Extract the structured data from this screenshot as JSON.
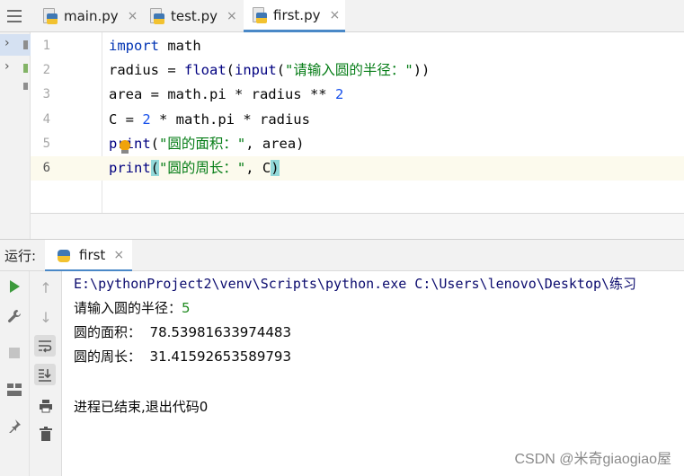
{
  "tabs": [
    {
      "label": "main.py",
      "close": "×"
    },
    {
      "label": "test.py",
      "close": "×"
    },
    {
      "label": "first.py",
      "close": "×"
    }
  ],
  "editor": {
    "line_numbers": [
      "1",
      "2",
      "3",
      "4",
      "5",
      "6"
    ],
    "code": {
      "l1_kw": "import",
      "l1_rest": " math",
      "l2_a": "radius = ",
      "l2_float": "float",
      "l2_b": "(",
      "l2_input": "input",
      "l2_c": "(",
      "l2_str": "\"请输入圆的半径：\"",
      "l2_d": "))",
      "l3_a": "area = math.pi * radius ** ",
      "l3_num": "2",
      "l4_a": "C = ",
      "l4_num": "2",
      "l4_b": " * math.pi * radius",
      "l5_fn": "print",
      "l5_a": "(",
      "l5_str": "\"圆的面积：\"",
      "l5_b": ", area)",
      "l6_fn": "print",
      "l6_a": "(",
      "l6_str": "\"圆的周长：\"",
      "l6_b": ", C",
      "l6_c": ")"
    }
  },
  "run": {
    "label": "运行:",
    "tab_label": "first",
    "tab_close": "×"
  },
  "console": {
    "cmd": "E:\\pythonProject2\\venv\\Scripts\\python.exe C:\\Users\\lenovo\\Desktop\\练习",
    "prompt": "请输入圆的半径：",
    "input_value": "5",
    "area_line": "圆的面积：  78.53981633974483",
    "circ_line": "圆的周长：  31.41592653589793",
    "exit_line": "进程已结束,退出代码0"
  },
  "watermark": "CSDN @米奇giaogiao屋",
  "colors": {
    "keyword": "#0033b3",
    "string": "#067d17",
    "number": "#1750eb",
    "accent": "#4a88c7",
    "run_green": "#3c9a3c"
  }
}
